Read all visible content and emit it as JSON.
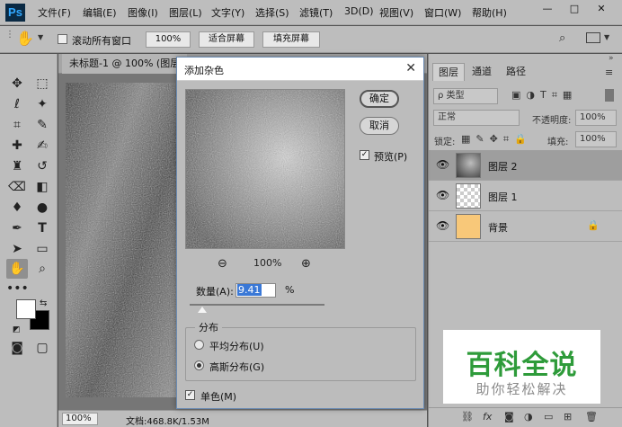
{
  "app": {
    "logo": "Ps"
  },
  "menu": {
    "items": [
      "文件(F)",
      "编辑(E)",
      "图像(I)",
      "图层(L)",
      "文字(Y)",
      "选择(S)",
      "滤镜(T)",
      "3D(D)",
      "视图(V)",
      "窗口(W)",
      "帮助(H)"
    ],
    "window_controls": [
      "—",
      "□",
      "✕"
    ]
  },
  "options_bar": {
    "scroll_all_label": "滚动所有窗口",
    "zoom_value": "100%",
    "fit_screen": "适合屏幕",
    "fill_screen": "填充屏幕"
  },
  "document": {
    "tab_title": "未标题-1 @ 100% (图层",
    "zoom": "100%",
    "info": "文档:468.8K/1.53M"
  },
  "layers_panel": {
    "tabs": [
      "图层",
      "通道",
      "路径"
    ],
    "filter_label": "ρ 类型",
    "blend_mode": "正常",
    "opacity_label": "不透明度:",
    "opacity_value": "100%",
    "lock_label": "锁定:",
    "fill_label": "填充:",
    "fill_value": "100%",
    "layers": [
      {
        "name": "图层 2",
        "selected": true
      },
      {
        "name": "图层 1",
        "selected": false
      },
      {
        "name": "背景",
        "selected": false,
        "locked": true,
        "color": "#f8c879"
      }
    ]
  },
  "dialog": {
    "title": "添加杂色",
    "ok": "确定",
    "cancel": "取消",
    "preview_label": "预览(P)",
    "preview_checked": true,
    "zoom_level": "100%",
    "amount_label": "数量(A):",
    "amount_value": "9.41",
    "amount_unit": "%",
    "amount_fraction": 0.094,
    "distribution_title": "分布",
    "uniform_label": "平均分布(U)",
    "gaussian_label": "高斯分布(G)",
    "selected_distribution": "gaussian",
    "mono_label": "单色(M)",
    "mono_checked": true
  },
  "watermark": {
    "title": "百科全说",
    "subtitle": "助你轻松解决"
  },
  "colors": {
    "foreground": "#ffffff",
    "background": "#000000",
    "title_bar": "#ffffff",
    "watermark_green": "#2e9b3a"
  }
}
